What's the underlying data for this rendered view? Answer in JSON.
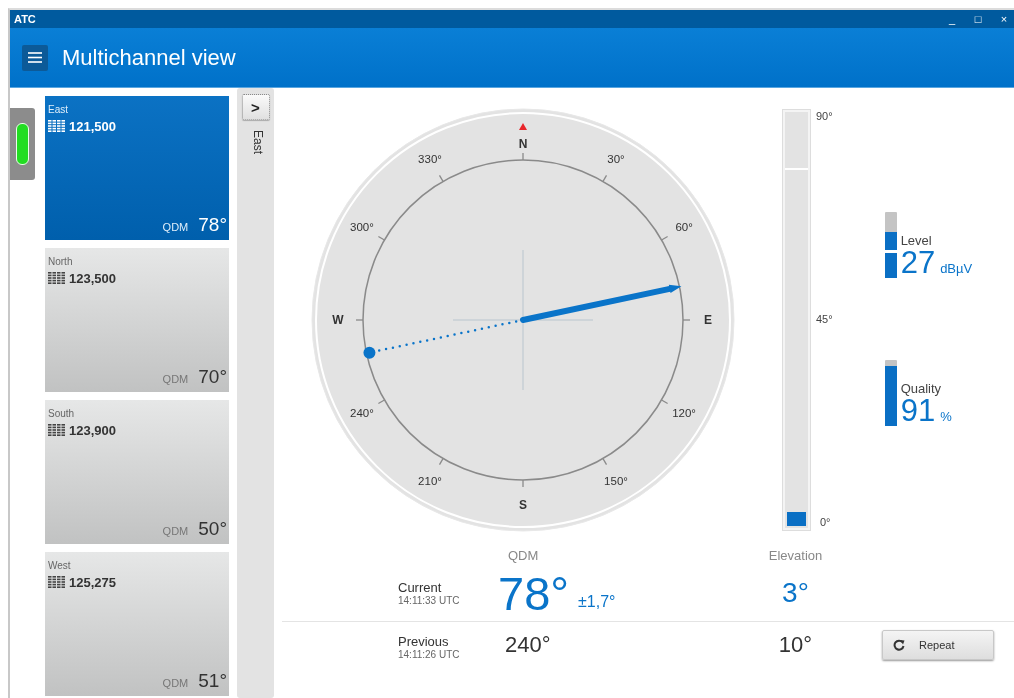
{
  "window": {
    "title": "ATC",
    "controls": [
      "_",
      "□",
      "×"
    ]
  },
  "header": {
    "title": "Multichannel view"
  },
  "channels": [
    {
      "name": "East",
      "frequency": "121,500",
      "qdm_label": "QDM",
      "qdm": "78°",
      "selected": true
    },
    {
      "name": "North",
      "frequency": "123,500",
      "qdm_label": "QDM",
      "qdm": "70°",
      "selected": false
    },
    {
      "name": "South",
      "frequency": "123,900",
      "qdm_label": "QDM",
      "qdm": "50°",
      "selected": false
    },
    {
      "name": "West",
      "frequency": "125,275",
      "qdm_label": "QDM",
      "qdm": "51°",
      "selected": false
    }
  ],
  "side_panel": {
    "toggle": ">",
    "label": "East"
  },
  "compass": {
    "labels": [
      "N",
      "30°",
      "60°",
      "E",
      "120°",
      "150°",
      "S",
      "210°",
      "240°",
      "W",
      "300°",
      "330°"
    ]
  },
  "elevation_gauge": {
    "labels": [
      "90°",
      "45°",
      "0°"
    ],
    "level": 0.035
  },
  "meters": [
    {
      "label": "Level",
      "value": "27",
      "unit": "dBµV",
      "level": 0.7
    },
    {
      "label": "Quality",
      "value": "91",
      "unit": "%",
      "level": 0.91
    }
  ],
  "readings": {
    "columns": [
      "QDM",
      "Elevation"
    ],
    "rows": [
      {
        "kind": "current",
        "label": "Current",
        "time": "14:11:33 UTC",
        "qdm": "78°",
        "tolerance": "±1,7°",
        "elevation": "3°"
      },
      {
        "kind": "previous",
        "label": "Previous",
        "time": "14:11:26 UTC",
        "qdm": "240°",
        "elevation": "10°"
      }
    ]
  },
  "repeat_button": {
    "label": "Repeat"
  }
}
